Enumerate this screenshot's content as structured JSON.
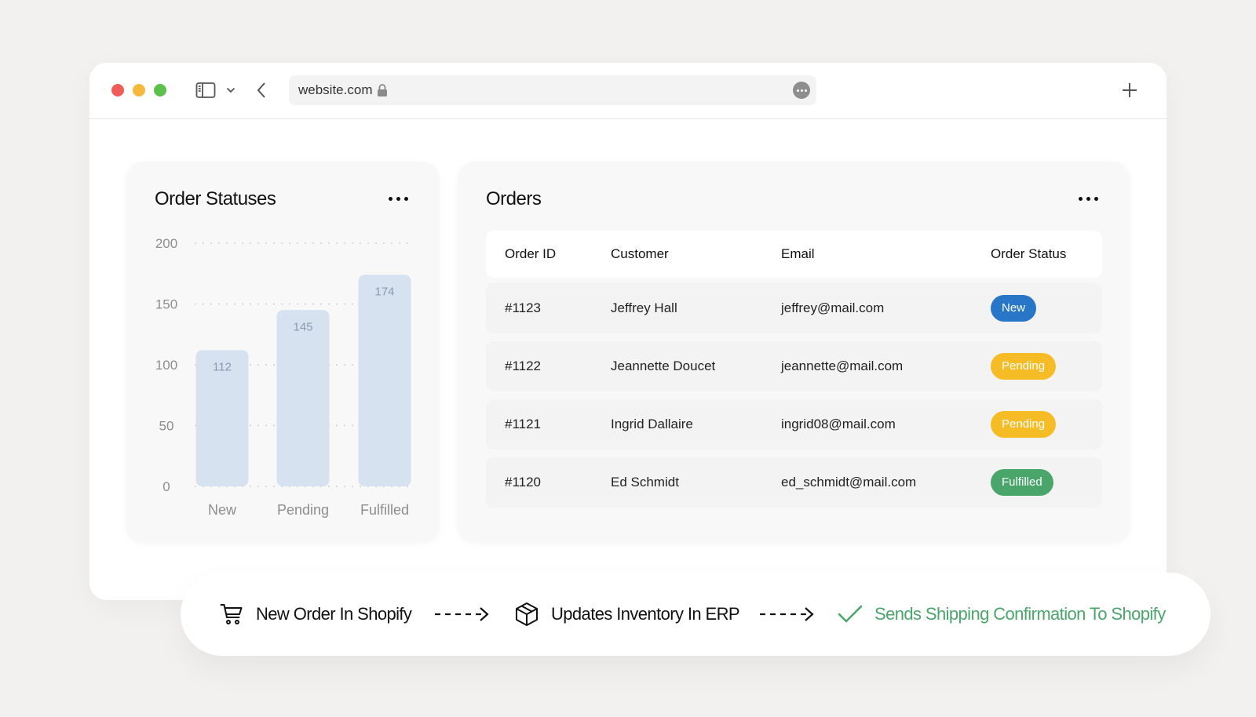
{
  "browser": {
    "url": "website.com",
    "icons": {
      "sidebar_toggle": "sidebar-icon",
      "chevron": "chevron-down-icon",
      "back": "chevron-left-icon",
      "lock": "lock-icon",
      "more": "more-horizontal-icon",
      "new_tab": "plus-icon"
    }
  },
  "chart_card": {
    "title": "Order Statuses",
    "menu_icon": "more-horizontal-icon"
  },
  "chart_data": {
    "type": "bar",
    "title": "Order Statuses",
    "xlabel": "",
    "ylabel": "",
    "categories": [
      "New",
      "Pending",
      "Fulfilled"
    ],
    "values": [
      112,
      145,
      174
    ],
    "ylim": [
      0,
      200
    ],
    "yticks": [
      0,
      50,
      100,
      150,
      200
    ],
    "grid": true,
    "bar_color": "#d6e2f0",
    "label_color": "#8a9aae"
  },
  "orders_card": {
    "title": "Orders",
    "menu_icon": "more-horizontal-icon",
    "columns": [
      "Order ID",
      "Customer",
      "Email",
      "Order Status"
    ],
    "rows": [
      {
        "id": "#1123",
        "customer": "Jeffrey Hall",
        "email": "jeffrey@mail.com",
        "status": "New",
        "status_color": "#2776c8"
      },
      {
        "id": "#1122",
        "customer": "Jeannette Doucet",
        "email": "jeannette@mail.com",
        "status": "Pending",
        "status_color": "#f5bc26"
      },
      {
        "id": "#1121",
        "customer": "Ingrid Dallaire",
        "email": "ingrid08@mail.com",
        "status": "Pending",
        "status_color": "#f5bc26"
      },
      {
        "id": "#1120",
        "customer": "Ed Schmidt",
        "email": "ed_schmidt@mail.com",
        "status": "Fulfilled",
        "status_color": "#4aa56a"
      }
    ]
  },
  "workflow": {
    "steps": [
      {
        "label": "New Order In Shopify",
        "icon": "shopping-cart-icon"
      },
      {
        "label": "Updates Inventory In ERP",
        "icon": "package-box-icon"
      },
      {
        "label": "Sends Shipping Confirmation To Shopify",
        "icon": "checkmark-icon",
        "color": "#4aa56a"
      }
    ],
    "connector_icon": "dashed-arrow-right-icon"
  },
  "colors": {
    "background": "#f3f1ef",
    "window": "#ffffff",
    "card": "#f8f8f8",
    "traffic_red": "#ee5d57",
    "traffic_yellow": "#f4b93d",
    "traffic_green": "#5cc14a"
  }
}
